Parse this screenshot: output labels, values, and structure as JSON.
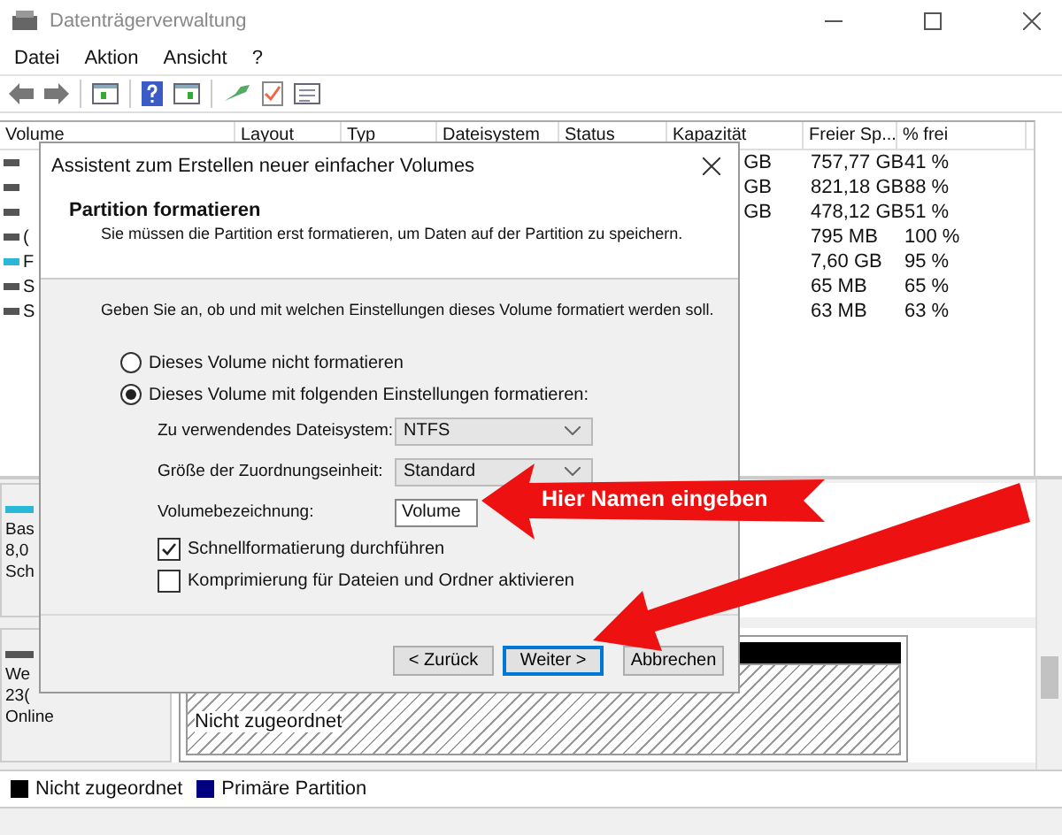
{
  "window": {
    "title": "Datenträgerverwaltung"
  },
  "menu": [
    "Datei",
    "Aktion",
    "Ansicht",
    "?"
  ],
  "table": {
    "columns": [
      "Volume",
      "Layout",
      "Typ",
      "Dateisystem",
      "Status",
      "Kapazität",
      "Freier Sp...",
      "% frei"
    ],
    "rows": [
      {
        "capacity": "GB",
        "free": "757,77 GB",
        "percent": "41 %",
        "color": "#555555"
      },
      {
        "capacity": "GB",
        "free": "821,18 GB",
        "percent": "88 %",
        "color": "#555555"
      },
      {
        "capacity": "GB",
        "free": "478,12 GB",
        "percent": "51 %",
        "color": "#555555"
      },
      {
        "volume": "(",
        "free": "795 MB",
        "percent": "100 %",
        "color": "#555555"
      },
      {
        "volume": "F",
        "free": "7,60 GB",
        "percent": "95 %",
        "color": "#2bb8d8"
      },
      {
        "volume": "S",
        "free": "65 MB",
        "percent": "65 %",
        "color": "#555555"
      },
      {
        "volume": "S",
        "free": "63 MB",
        "percent": "63 %",
        "color": "#555555"
      }
    ]
  },
  "disks": [
    {
      "lines": [
        "Bas",
        "8,0",
        "Sch"
      ],
      "color": "#2bb8d8"
    },
    {
      "lines": [
        "We",
        "23(",
        "Online"
      ],
      "color": "#555555",
      "partitions": [
        {
          "label": "Nicht zugeordnet",
          "color": "#000000"
        }
      ]
    }
  ],
  "legend": [
    {
      "label": "Nicht zugeordnet",
      "color": "#000000"
    },
    {
      "label": "Primäre Partition",
      "color": "#000080"
    }
  ],
  "dialog": {
    "title": "Assistent zum Erstellen neuer einfacher Volumes",
    "heading": "Partition formatieren",
    "subtitle": "Sie müssen die Partition erst formatieren, um Daten auf der Partition zu speichern.",
    "instruction": "Geben Sie an, ob und mit welchen Einstellungen dieses Volume formatiert werden soll.",
    "radios": [
      {
        "label": "Dieses Volume nicht formatieren",
        "selected": false
      },
      {
        "label": "Dieses Volume mit folgenden Einstellungen formatieren:",
        "selected": true
      }
    ],
    "fields": [
      {
        "label": "Zu verwendendes Dateisystem:",
        "value": "NTFS",
        "kind": "select"
      },
      {
        "label": "Größe der Zuordnungseinheit:",
        "value": "Standard",
        "kind": "select"
      },
      {
        "label": "Volumebezeichnung:",
        "value": "Volume",
        "kind": "text"
      }
    ],
    "checkboxes": [
      {
        "label": "Schnellformatierung durchführen",
        "checked": true
      },
      {
        "label": "Komprimierung für Dateien und Ordner aktivieren",
        "checked": false
      }
    ],
    "buttons": [
      {
        "label": "< Zurück",
        "default": false
      },
      {
        "label": "Weiter >",
        "default": true
      },
      {
        "label": "Abbrechen",
        "default": false
      }
    ]
  },
  "annotation": {
    "text": "Hier Namen eingeben"
  }
}
